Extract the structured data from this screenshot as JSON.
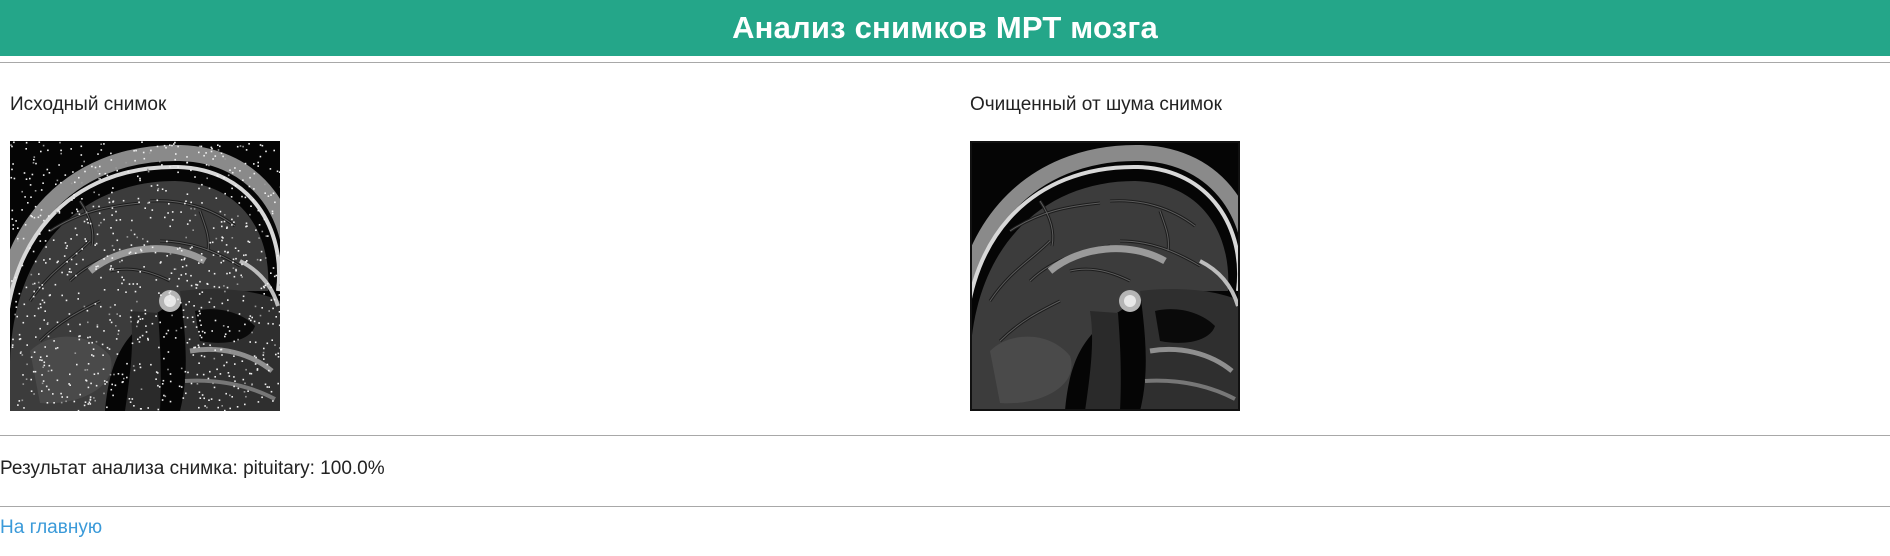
{
  "header": {
    "title": "Анализ снимков МРТ мозга",
    "bg_color": "#24a689"
  },
  "images": {
    "original": {
      "caption": "Исходный снимок",
      "type": "noisy"
    },
    "denoised": {
      "caption": "Очищенный от шума снимок",
      "type": "clean"
    }
  },
  "result": {
    "text": "Результат анализа снимка: pituitary: 100.0%"
  },
  "nav": {
    "home_label": "На главную",
    "link_color": "#3a9ad9"
  }
}
